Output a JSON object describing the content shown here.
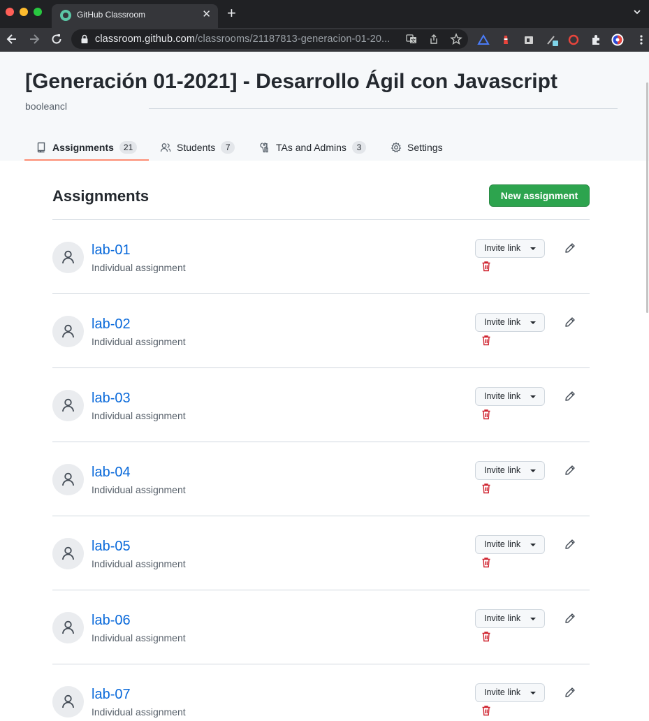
{
  "browser": {
    "tab_title": "GitHub Classroom",
    "url_host": "classroom.github.com",
    "url_path": "/classrooms/21187813-generacion-01-20...",
    "icons": [
      "github-favicon",
      "back-arrow-icon",
      "forward-arrow-icon",
      "reload-icon",
      "lock-icon",
      "translate-icon",
      "share-icon",
      "star-icon",
      "extensions-icon",
      "profile-avatar",
      "menu-kebab-icon"
    ]
  },
  "header": {
    "title": "[Generación 01-2021] - Desarrollo Ágil con Javascript",
    "org": "booleancl"
  },
  "tabs": [
    {
      "label": "Assignments",
      "count": "21",
      "icon": "book-icon"
    },
    {
      "label": "Students",
      "count": "7",
      "icon": "people-icon"
    },
    {
      "label": "TAs and Admins",
      "count": "3",
      "icon": "tools-icon"
    },
    {
      "label": "Settings",
      "icon": "gear-icon"
    }
  ],
  "main": {
    "section_title": "Assignments",
    "new_button": "New assignment",
    "invite_label": "Invite link"
  },
  "assignments": [
    {
      "name": "lab-01",
      "type": "Individual assignment"
    },
    {
      "name": "lab-02",
      "type": "Individual assignment"
    },
    {
      "name": "lab-03",
      "type": "Individual assignment"
    },
    {
      "name": "lab-04",
      "type": "Individual assignment"
    },
    {
      "name": "lab-05",
      "type": "Individual assignment"
    },
    {
      "name": "lab-06",
      "type": "Individual assignment"
    },
    {
      "name": "lab-07",
      "type": "Individual assignment"
    }
  ],
  "colors": {
    "link": "#0969da",
    "primary_button": "#2da44e",
    "danger": "#cf222e",
    "tab_underline": "#fd8c73"
  }
}
